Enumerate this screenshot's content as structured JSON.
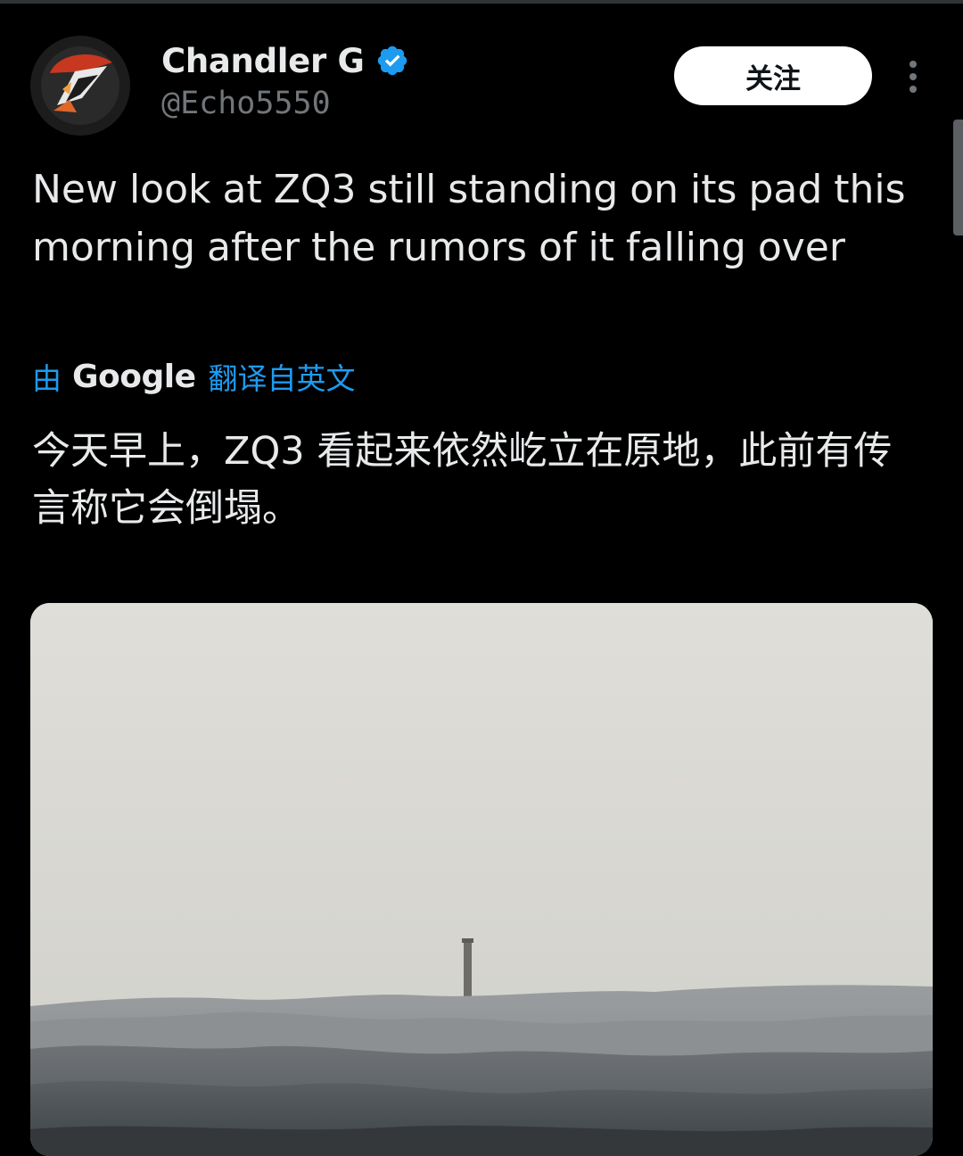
{
  "author": {
    "display_name": "Chandler G",
    "handle": "@Echo5550",
    "verified": true,
    "avatar_icon": "avatar-emblem-icon"
  },
  "actions": {
    "follow_label": "关注",
    "more_icon": "more-options-icon"
  },
  "tweet": {
    "text": "New look at ZQ3 still standing on its pad this morning after the rumors of it falling over",
    "translation_prefix": "由",
    "translation_provider": "Google",
    "translation_suffix": "翻译自英文",
    "translated_text": "今天早上，ZQ3 看起来依然屹立在原地，此前有传言称它会倒塌。"
  },
  "media": {
    "image_icon": "rocket-on-pad-photo"
  },
  "colors": {
    "background": "#000000",
    "primary_text": "#e7e9ea",
    "secondary_text": "#71767b",
    "link": "#1d9bf0",
    "verified": "#1d9bf0",
    "follow_button_bg": "#ffffff"
  }
}
